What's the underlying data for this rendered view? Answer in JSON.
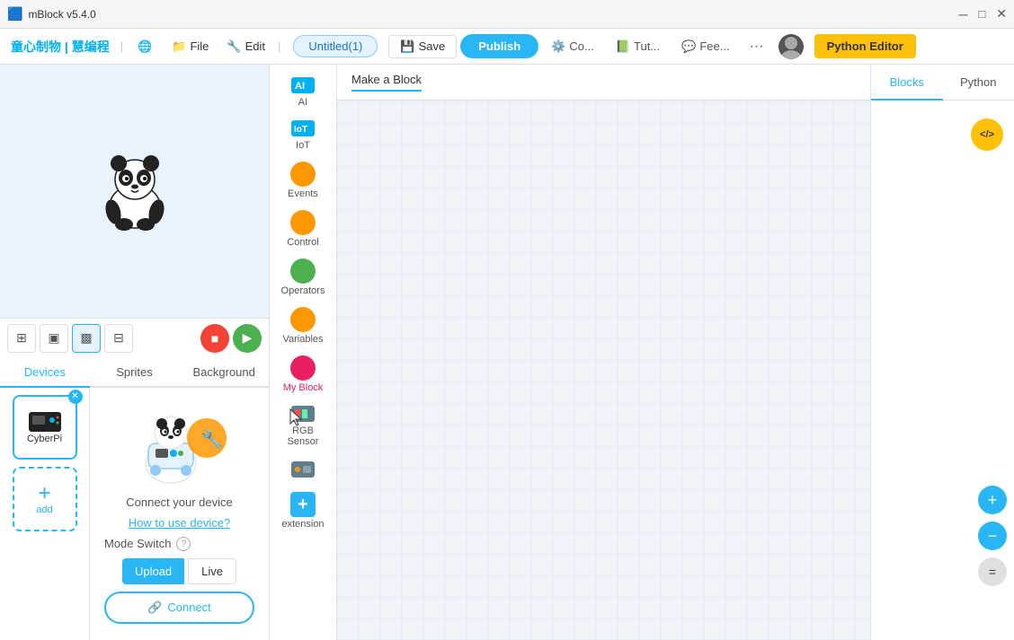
{
  "titlebar": {
    "app_name": "mBlock v5.4.0"
  },
  "menubar": {
    "logo": "童心制物 | 慧编程",
    "globe_icon": "🌐",
    "file_label": "File",
    "edit_label": "Edit",
    "project_title": "Untitled(1)",
    "save_label": "Save",
    "publish_label": "Publish",
    "connect_label": "Co...",
    "tutorial_label": "Tut...",
    "feedback_label": "Fee...",
    "more_label": "···",
    "python_editor_label": "Python Editor"
  },
  "stage": {
    "panda_alt": "Panda sprite"
  },
  "stage_controls": {
    "layout_icon1": "⊞",
    "layout_icon2": "▣",
    "layout_icon3": "▩",
    "layout_icon4": "⊟",
    "stop_icon": "■",
    "play_icon": "▶"
  },
  "tabs": {
    "devices_label": "Devices",
    "sprites_label": "Sprites",
    "background_label": "Background"
  },
  "device_panel": {
    "device_name": "CyberPi",
    "add_label": "add",
    "connect_illustration_alt": "Connect device illustration",
    "connect_text": "Connect your device",
    "how_to_label": "How to use device?",
    "mode_switch_label": "Mode Switch",
    "help_icon": "?",
    "upload_label": "Upload",
    "live_label": "Live",
    "connect_label": "Connect",
    "link_icon": "🔗"
  },
  "block_sidebar": {
    "categories": [
      {
        "id": "ai",
        "label": "AI",
        "color": "#00b0f0",
        "type": "rect"
      },
      {
        "id": "iot",
        "label": "IoT",
        "color": "#00b0f0",
        "type": "rect"
      },
      {
        "id": "events",
        "label": "Events",
        "color": "#ff9800",
        "type": "dot"
      },
      {
        "id": "control",
        "label": "Control",
        "color": "#ff9800",
        "type": "dot"
      },
      {
        "id": "operators",
        "label": "Operators",
        "color": "#4caf50",
        "type": "dot"
      },
      {
        "id": "variables",
        "label": "Variables",
        "color": "#ff9800",
        "type": "dot"
      },
      {
        "id": "my_block",
        "label": "My Block",
        "color": "#e91e63",
        "type": "dot"
      },
      {
        "id": "rgb_sensor",
        "label": "RGB Sensor",
        "color": "#607d8b",
        "type": "rect"
      },
      {
        "id": "extra",
        "label": "",
        "color": "#607d8b",
        "type": "rect"
      },
      {
        "id": "extension",
        "label": "extension",
        "color": "#29b6f6",
        "type": "plus"
      }
    ]
  },
  "coding_area": {
    "make_block_label": "Make a Block"
  },
  "right_panel": {
    "blocks_label": "Blocks",
    "python_label": "Python",
    "code_toggle_icon": "</>",
    "zoom_in_icon": "+",
    "zoom_out_icon": "−",
    "zoom_reset_icon": "="
  }
}
